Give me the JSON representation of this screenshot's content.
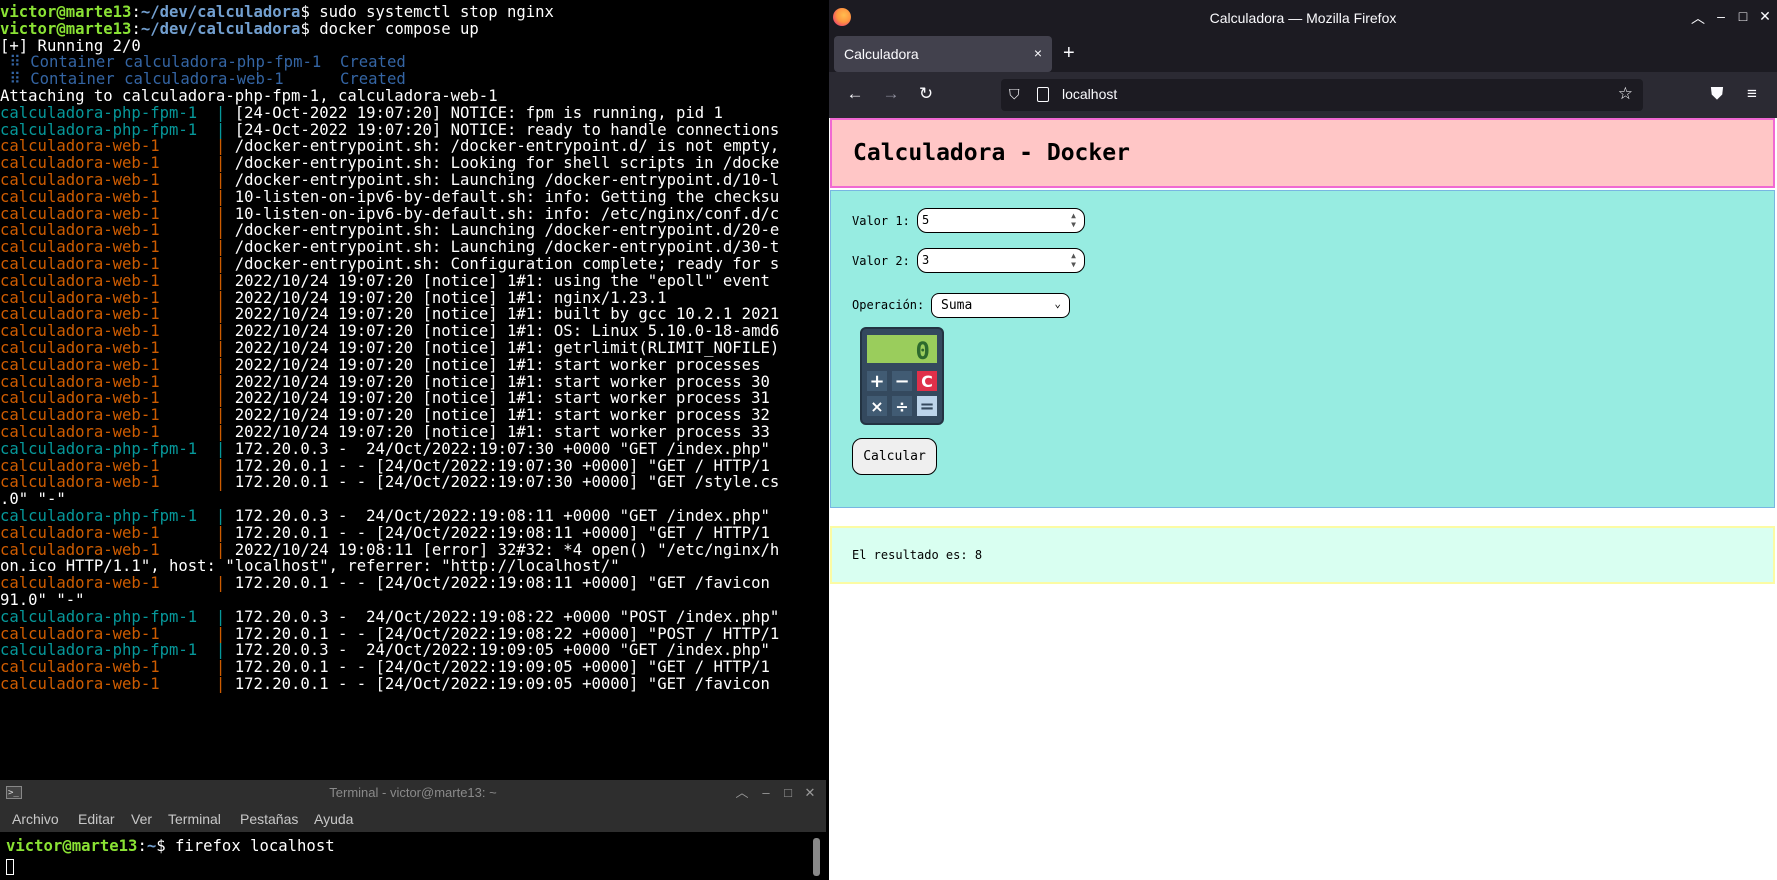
{
  "terminal_top": {
    "lines": [
      {
        "segments": [
          {
            "text": "victor@marte13",
            "color": "green"
          },
          {
            "text": ":",
            "color": "white"
          },
          {
            "text": "~/dev/calculadora",
            "color": "blue"
          },
          {
            "text": "$ sudo systemctl stop nginx",
            "color": "white"
          }
        ]
      },
      {
        "segments": [
          {
            "text": "victor@marte13",
            "color": "green"
          },
          {
            "text": ":",
            "color": "white"
          },
          {
            "text": "~/dev/calculadora",
            "color": "blue"
          },
          {
            "text": "$ docker compose up",
            "color": "white"
          }
        ]
      },
      {
        "segments": [
          {
            "text": "[+] Running 2/0",
            "color": "white"
          }
        ]
      },
      {
        "segments": [
          {
            "text": " ⠿ Container calculadora-php-fpm-1  Created",
            "color": "dblue"
          }
        ]
      },
      {
        "segments": [
          {
            "text": " ⠿ Container calculadora-web-1      Created",
            "color": "dblue"
          }
        ]
      },
      {
        "segments": [
          {
            "text": "Attaching to calculadora-php-fpm-1, calculadora-web-1",
            "color": "white"
          }
        ]
      },
      {
        "segments": [
          {
            "text": "calculadora-php-fpm-1  | ",
            "color": "cyan"
          },
          {
            "text": "[24-Oct-2022 19:07:20] NOTICE: fpm is running, pid 1",
            "color": "white"
          }
        ]
      },
      {
        "segments": [
          {
            "text": "calculadora-php-fpm-1  | ",
            "color": "cyan"
          },
          {
            "text": "[24-Oct-2022 19:07:20] NOTICE: ready to handle connections",
            "color": "white"
          }
        ]
      },
      {
        "segments": [
          {
            "text": "calculadora-web-1      | ",
            "color": "orange"
          },
          {
            "text": "/docker-entrypoint.sh: /docker-entrypoint.d/ is not empty,",
            "color": "white"
          }
        ]
      },
      {
        "segments": [
          {
            "text": "calculadora-web-1      | ",
            "color": "orange"
          },
          {
            "text": "/docker-entrypoint.sh: Looking for shell scripts in /docke",
            "color": "white"
          }
        ]
      },
      {
        "segments": [
          {
            "text": "calculadora-web-1      | ",
            "color": "orange"
          },
          {
            "text": "/docker-entrypoint.sh: Launching /docker-entrypoint.d/10-l",
            "color": "white"
          }
        ]
      },
      {
        "segments": [
          {
            "text": "calculadora-web-1      | ",
            "color": "orange"
          },
          {
            "text": "10-listen-on-ipv6-by-default.sh: info: Getting the checksu",
            "color": "white"
          }
        ]
      },
      {
        "segments": [
          {
            "text": "calculadora-web-1      | ",
            "color": "orange"
          },
          {
            "text": "10-listen-on-ipv6-by-default.sh: info: /etc/nginx/conf.d/c",
            "color": "white"
          }
        ]
      },
      {
        "segments": [
          {
            "text": "calculadora-web-1      | ",
            "color": "orange"
          },
          {
            "text": "/docker-entrypoint.sh: Launching /docker-entrypoint.d/20-e",
            "color": "white"
          }
        ]
      },
      {
        "segments": [
          {
            "text": "calculadora-web-1      | ",
            "color": "orange"
          },
          {
            "text": "/docker-entrypoint.sh: Launching /docker-entrypoint.d/30-t",
            "color": "white"
          }
        ]
      },
      {
        "segments": [
          {
            "text": "calculadora-web-1      | ",
            "color": "orange"
          },
          {
            "text": "/docker-entrypoint.sh: Configuration complete; ready for s",
            "color": "white"
          }
        ]
      },
      {
        "segments": [
          {
            "text": "calculadora-web-1      | ",
            "color": "orange"
          },
          {
            "text": "2022/10/24 19:07:20 [notice] 1#1: using the \"epoll\" event",
            "color": "white"
          }
        ]
      },
      {
        "segments": [
          {
            "text": "calculadora-web-1      | ",
            "color": "orange"
          },
          {
            "text": "2022/10/24 19:07:20 [notice] 1#1: nginx/1.23.1",
            "color": "white"
          }
        ]
      },
      {
        "segments": [
          {
            "text": "calculadora-web-1      | ",
            "color": "orange"
          },
          {
            "text": "2022/10/24 19:07:20 [notice] 1#1: built by gcc 10.2.1 2021",
            "color": "white"
          }
        ]
      },
      {
        "segments": [
          {
            "text": "calculadora-web-1      | ",
            "color": "orange"
          },
          {
            "text": "2022/10/24 19:07:20 [notice] 1#1: OS: Linux 5.10.0-18-amd6",
            "color": "white"
          }
        ]
      },
      {
        "segments": [
          {
            "text": "calculadora-web-1      | ",
            "color": "orange"
          },
          {
            "text": "2022/10/24 19:07:20 [notice] 1#1: getrlimit(RLIMIT_NOFILE)",
            "color": "white"
          }
        ]
      },
      {
        "segments": [
          {
            "text": "calculadora-web-1      | ",
            "color": "orange"
          },
          {
            "text": "2022/10/24 19:07:20 [notice] 1#1: start worker processes",
            "color": "white"
          }
        ]
      },
      {
        "segments": [
          {
            "text": "calculadora-web-1      | ",
            "color": "orange"
          },
          {
            "text": "2022/10/24 19:07:20 [notice] 1#1: start worker process 30",
            "color": "white"
          }
        ]
      },
      {
        "segments": [
          {
            "text": "calculadora-web-1      | ",
            "color": "orange"
          },
          {
            "text": "2022/10/24 19:07:20 [notice] 1#1: start worker process 31",
            "color": "white"
          }
        ]
      },
      {
        "segments": [
          {
            "text": "calculadora-web-1      | ",
            "color": "orange"
          },
          {
            "text": "2022/10/24 19:07:20 [notice] 1#1: start worker process 32",
            "color": "white"
          }
        ]
      },
      {
        "segments": [
          {
            "text": "calculadora-web-1      | ",
            "color": "orange"
          },
          {
            "text": "2022/10/24 19:07:20 [notice] 1#1: start worker process 33",
            "color": "white"
          }
        ]
      },
      {
        "segments": [
          {
            "text": "calculadora-php-fpm-1  | ",
            "color": "cyan"
          },
          {
            "text": "172.20.0.3 -  24/Oct/2022:19:07:30 +0000 \"GET /index.php\"",
            "color": "white"
          }
        ]
      },
      {
        "segments": [
          {
            "text": "calculadora-web-1      | ",
            "color": "orange"
          },
          {
            "text": "172.20.0.1 - - [24/Oct/2022:19:07:30 +0000] \"GET / HTTP/1",
            "color": "white"
          }
        ]
      },
      {
        "segments": [
          {
            "text": "calculadora-web-1      | ",
            "color": "orange"
          },
          {
            "text": "172.20.0.1 - - [24/Oct/2022:19:07:30 +0000] \"GET /style.cs",
            "color": "white"
          }
        ]
      },
      {
        "segments": [
          {
            "text": ".0\" \"-\"",
            "color": "white"
          }
        ]
      },
      {
        "segments": [
          {
            "text": "calculadora-php-fpm-1  | ",
            "color": "cyan"
          },
          {
            "text": "172.20.0.3 -  24/Oct/2022:19:08:11 +0000 \"GET /index.php\"",
            "color": "white"
          }
        ]
      },
      {
        "segments": [
          {
            "text": "calculadora-web-1      | ",
            "color": "orange"
          },
          {
            "text": "172.20.0.1 - - [24/Oct/2022:19:08:11 +0000] \"GET / HTTP/1",
            "color": "white"
          }
        ]
      },
      {
        "segments": [
          {
            "text": "calculadora-web-1      | ",
            "color": "orange"
          },
          {
            "text": "2022/10/24 19:08:11 [error] 32#32: *4 open() \"/etc/nginx/h",
            "color": "white"
          }
        ]
      },
      {
        "segments": [
          {
            "text": "on.ico HTTP/1.1\", host: \"localhost\", referrer: \"http://localhost/\"",
            "color": "white"
          }
        ]
      },
      {
        "segments": [
          {
            "text": "calculadora-web-1      | ",
            "color": "orange"
          },
          {
            "text": "172.20.0.1 - - [24/Oct/2022:19:08:11 +0000] \"GET /favicon",
            "color": "white"
          }
        ]
      },
      {
        "segments": [
          {
            "text": "91.0\" \"-\"",
            "color": "white"
          }
        ]
      },
      {
        "segments": [
          {
            "text": "calculadora-php-fpm-1  | ",
            "color": "cyan"
          },
          {
            "text": "172.20.0.3 -  24/Oct/2022:19:08:22 +0000 \"POST /index.php\"",
            "color": "white"
          }
        ]
      },
      {
        "segments": [
          {
            "text": "calculadora-web-1      | ",
            "color": "orange"
          },
          {
            "text": "172.20.0.1 - - [24/Oct/2022:19:08:22 +0000] \"POST / HTTP/1",
            "color": "white"
          }
        ]
      },
      {
        "segments": [
          {
            "text": "calculadora-php-fpm-1  | ",
            "color": "cyan"
          },
          {
            "text": "172.20.0.3 -  24/Oct/2022:19:09:05 +0000 \"GET /index.php\"",
            "color": "white"
          }
        ]
      },
      {
        "segments": [
          {
            "text": "calculadora-web-1      | ",
            "color": "orange"
          },
          {
            "text": "172.20.0.1 - - [24/Oct/2022:19:09:05 +0000] \"GET / HTTP/1",
            "color": "white"
          }
        ]
      },
      {
        "segments": [
          {
            "text": "calculadora-web-1      | ",
            "color": "orange"
          },
          {
            "text": "172.20.0.1 - - [24/Oct/2022:19:09:05 +0000] \"GET /favicon",
            "color": "white"
          }
        ]
      }
    ]
  },
  "terminal_bottom": {
    "title": "Terminal - victor@marte13: ~",
    "menu": [
      "Archivo",
      "Editar",
      "Ver",
      "Terminal",
      "Pestañas",
      "Ayuda"
    ],
    "prompt_user": "victor@marte13",
    "prompt_sep": ":",
    "prompt_path": "~",
    "prompt_cmd": "$ firefox localhost",
    "icon": "terminal-icon"
  },
  "firefox": {
    "window_title": "Calculadora — Mozilla Firefox",
    "tab_title": "Calculadora",
    "url": "localhost",
    "icons": {
      "tab_close": "×",
      "new_tab": "+",
      "back": "←",
      "forward": "→",
      "reload": "↻",
      "shield": "⛉",
      "star": "☆",
      "pocket": "⛊",
      "menu": "≡",
      "win_min": "–",
      "win_max": "□",
      "win_close": "✕",
      "win_up": "︿"
    }
  },
  "page": {
    "title": "Calculadora - Docker",
    "valor1_label": "Valor 1:",
    "valor1_value": "5",
    "valor2_label": "Valor 2:",
    "valor2_value": "3",
    "operacion_label": "Operación:",
    "operacion_value": "Suma",
    "calc_display": "0",
    "calc_keys": [
      "+",
      "−",
      "C",
      "×",
      "÷",
      "="
    ],
    "calcular_label": "Calcular",
    "result_text": "El resultado es: 8"
  },
  "colors": {
    "header_bg": "#ffc6c6",
    "header_border": "#f069d2",
    "form_bg": "#97ece1",
    "result_bg": "#d9fff1",
    "result_border": "#fbfba4",
    "term_green": "#8ae234",
    "term_blue": "#729fcf",
    "term_cyan": "#06989a",
    "term_orange": "#ce5c00"
  }
}
